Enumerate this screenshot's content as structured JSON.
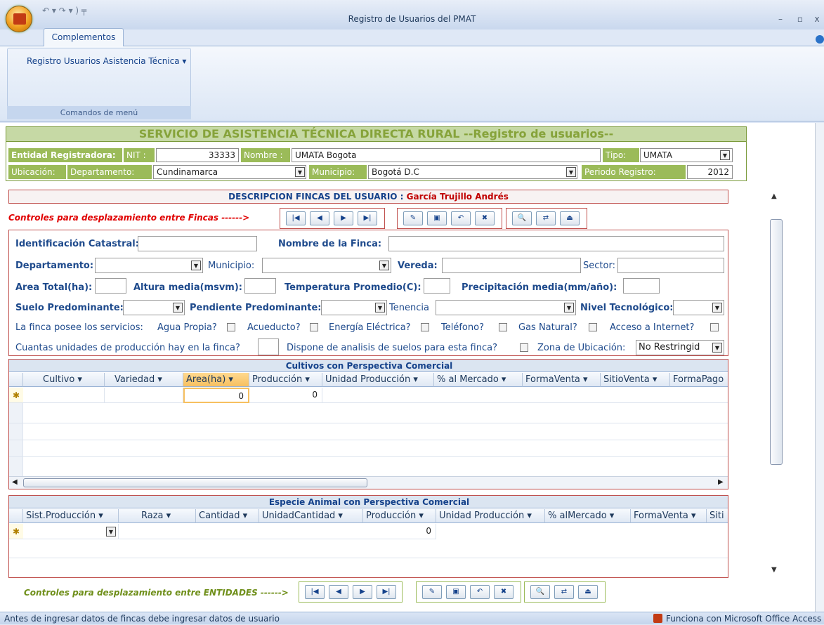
{
  "window": {
    "title": "Registro de Usuarios del PMAT",
    "qat": "↶ ▾ ↷ ▾ ) ╤",
    "min": "–",
    "max": "▫",
    "close": "x"
  },
  "ribbon": {
    "tab": "Complementos",
    "menu": "Registro Usuarios Asistencia Técnica ▾",
    "group_caption": "Comandos de menú"
  },
  "header": {
    "title": "SERVICIO DE ASISTENCIA TÉCNICA DIRECTA RURAL --Registro de usuarios--",
    "entidad_label": "Entidad Registradora:",
    "nit_label": "NIT :",
    "nit_value": "33333",
    "nombre_label": "Nombre :",
    "nombre_value": "UMATA Bogota",
    "tipo_label": "Tipo:",
    "tipo_value": "UMATA",
    "ubicacion_label": "Ubicación:",
    "departamento_label": "Departamento:",
    "departamento_value": "Cundinamarca",
    "municipio_label": "Municipio:",
    "municipio_value": "Bogotá D.C",
    "periodo_label": "Periodo Registro:",
    "periodo_value": "2012"
  },
  "desc": {
    "title": "DESCRIPCION FINCAS DEL USUARIO :",
    "user": "García Trujillo Andrés",
    "nav_label": "Controles para desplazamiento entre Fincas ------>"
  },
  "finca": {
    "catastral": "Identificación Catastral:",
    "nombre": "Nombre de la Finca:",
    "departamento": "Departamento:",
    "municipio": "Municipio:",
    "vereda": "Vereda:",
    "sector": "Sector:",
    "area": "Area Total(ha):",
    "altura": "Altura media(msvm):",
    "temperatura": "Temperatura Promedio(C):",
    "precipitacion": "Precipitación media(mm/año):",
    "suelo": "Suelo Predominante:",
    "pendiente": "Pendiente Predominante:",
    "tenencia": "Tenencia",
    "nivel": "Nivel Tecnológico:",
    "servicios": "La finca posee los servicios:",
    "agua": "Agua Propia?",
    "acueducto": "Acueducto?",
    "energia": "Energía Eléctrica?",
    "telefono": "Teléfono?",
    "gas": "Gas Natural?",
    "internet": "Acceso a Internet?",
    "unidades": "Cuantas unidades de producción hay en la finca?",
    "analisis": "Dispone de analisis de suelos para esta finca?",
    "zona": "Zona de Ubicación:",
    "zona_value": "No Restringid"
  },
  "cultivos": {
    "title": "Cultivos con Perspectiva Comercial",
    "columns": [
      "Cultivo ▾",
      "Variedad ▾",
      "Area(ha) ▾",
      "Producción ▾",
      "Unidad Producción ▾",
      "% al Mercado ▾",
      "FormaVenta ▾",
      "SitioVenta ▾",
      "FormaPago"
    ],
    "area_value": "0",
    "produccion_value": "0",
    "new_marker": "✱"
  },
  "especie": {
    "title": "Especie Animal  con Perspectiva Comercial",
    "columns": [
      "Sist.Producción ▾",
      "Raza ▾",
      "Cantidad ▾",
      "UnidadCantidad ▾",
      "Producción ▾",
      "Unidad Producción ▾",
      "% alMercado ▾",
      "FormaVenta ▾",
      "Siti"
    ],
    "produccion_value": "0",
    "new_marker": "✱"
  },
  "footer": {
    "nav_label": "Controles para desplazamiento entre ENTIDADES ------>"
  },
  "status": {
    "left": "Antes de ingresar datos de fincas debe ingresar datos de usuario",
    "right": "Funciona con Microsoft Office Access"
  },
  "nav": {
    "first": "|◀",
    "prev": "◀",
    "next": "▶",
    "last": "▶|",
    "new": "✎",
    "save": "▣",
    "undo": "↶",
    "delete": "✖",
    "find": "🔍",
    "replace": "⇄",
    "exit": "⏏"
  }
}
